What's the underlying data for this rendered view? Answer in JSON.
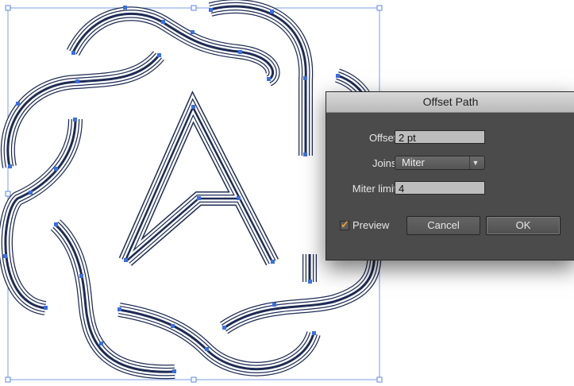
{
  "dialog": {
    "title": "Offset Path",
    "offset_label": "Offset:",
    "offset_value": "2 pt",
    "joins_label": "Joins:",
    "joins_value": "Miter",
    "miter_label": "Miter limit:",
    "miter_value": "4",
    "preview_label": "Preview",
    "preview_checked": true,
    "cancel_label": "Cancel",
    "ok_label": "OK"
  },
  "canvas": {
    "letter": "A",
    "path_colors": {
      "outer_stroke": "#1e2b54",
      "fill": "#ffffff",
      "inner_stroke": "#24315e",
      "selection": "#3a6fe0"
    }
  }
}
